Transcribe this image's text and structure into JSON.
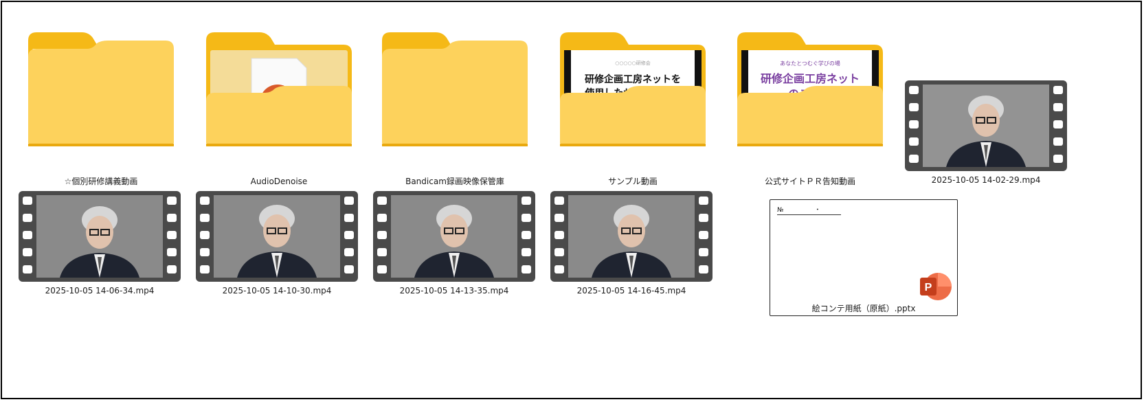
{
  "folders": [
    {
      "name": "☆個別研修講義動画",
      "preview": "docs"
    },
    {
      "name": "AudioDenoise",
      "preview": "media"
    },
    {
      "name": "Bandicam録画映像保管庫",
      "preview": "empty"
    },
    {
      "name": "サンプル動画",
      "preview": "slide",
      "slide_small": "○○○○○研修会",
      "slide_line1": "研修企画工房ネットを",
      "slide_line2": "使用したサンプル動画"
    },
    {
      "name": "公式サイトＰＲ告知動画",
      "preview": "slide2",
      "slide_small": "あなたとつむぐ学びの場",
      "slide_line1": "研修企画工房ネット",
      "slide_line2": "のご案内"
    }
  ],
  "videos": [
    {
      "name": "2025-10-05 14-02-29.mp4"
    },
    {
      "name": "2025-10-05 14-06-34.mp4"
    },
    {
      "name": "2025-10-05 14-10-30.mp4"
    },
    {
      "name": "2025-10-05 14-13-35.mp4"
    },
    {
      "name": "2025-10-05 14-16-45.mp4"
    }
  ],
  "pptx": {
    "name": "絵コンテ用紙（原紙）.pptx",
    "preview_text": "№　　　　　・",
    "app_letter": "P"
  },
  "colors": {
    "folder_back": "#f5b917",
    "folder_front": "#fdd25c",
    "ppt_red": "#c43e1c",
    "film_frame": "#4a4a4a"
  }
}
